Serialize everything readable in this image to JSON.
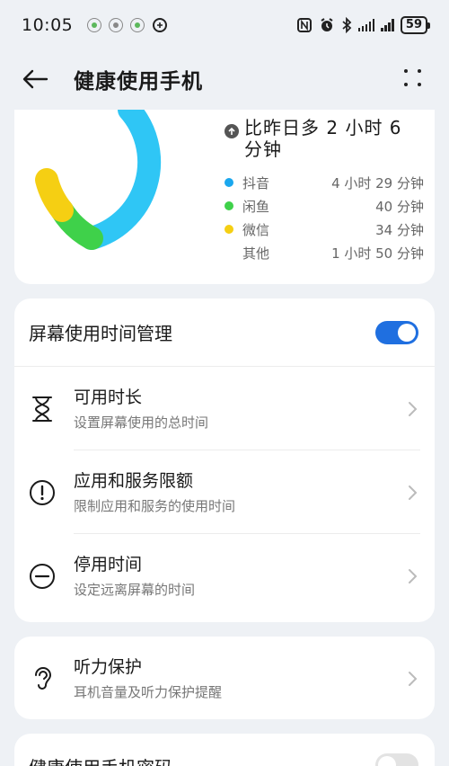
{
  "status_bar": {
    "time": "10:05",
    "battery": "59"
  },
  "header": {
    "title": "健康使用手机"
  },
  "summary": {
    "compare_text": "比昨日多 2 小时 6 分钟",
    "legend": [
      {
        "name": "抖音",
        "value": "4 小时 29 分钟",
        "color": "#1aa7ee"
      },
      {
        "name": "闲鱼",
        "value": "40 分钟",
        "color": "#3fd14a"
      },
      {
        "name": "微信",
        "value": "34 分钟",
        "color": "#f5cf13"
      },
      {
        "name": "其他",
        "value": "1 小时 50 分钟",
        "color": ""
      }
    ]
  },
  "management": {
    "toggle_label": "屏幕使用时间管理",
    "toggle_on": true,
    "items": [
      {
        "title": "可用时长",
        "subtitle": "设置屏幕使用的总时间",
        "icon": "hourglass-icon"
      },
      {
        "title": "应用和服务限额",
        "subtitle": "限制应用和服务的使用时间",
        "icon": "alert-circle-icon"
      },
      {
        "title": "停用时间",
        "subtitle": "设定远离屏幕的时间",
        "icon": "minus-circle-icon"
      }
    ]
  },
  "hearing": {
    "title": "听力保护",
    "subtitle": "耳机音量及听力保护提醒",
    "icon": "ear-icon"
  },
  "password": {
    "title": "健康使用手机密码",
    "toggle_on": false
  }
}
